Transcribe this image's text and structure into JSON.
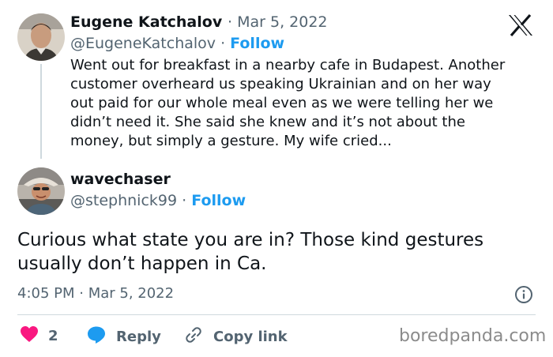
{
  "quoted_tweet": {
    "author_name": "Eugene Katchalov",
    "date": "Mar 5, 2022",
    "handle": "@EugeneKatchalov",
    "follow_label": "Follow",
    "text_lines": [
      "Went out for breakfast in a nearby cafe in Budapest. Another",
      "customer overheard us speaking Ukrainian and on her way",
      "out paid for our whole meal even as we were telling her we",
      "didn’t need it. She said she knew and it’s not about the",
      "money, but simply a gesture. My wife cried..."
    ]
  },
  "reply_tweet": {
    "author_name": "wavechaser",
    "handle": "@stephnick99",
    "follow_label": "Follow",
    "text_lines": [
      "Curious what state you are in? Those kind gestures",
      "usually don’t happen in Ca."
    ],
    "timestamp": "4:05 PM · Mar 5, 2022"
  },
  "actions": {
    "like_count": "2",
    "reply_label": "Reply",
    "copy_label": "Copy link"
  },
  "separator": "·",
  "watermark": "boredpanda.com",
  "colors": {
    "text": "#0f1419",
    "secondary": "#536471",
    "link": "#1d9bf0",
    "like": "#f91880",
    "reply_icon": "#1d9bf0"
  },
  "icons": {
    "logo": "x-logo-icon",
    "info": "info-icon",
    "like": "heart-icon",
    "reply": "speech-bubble-icon",
    "copy": "link-icon"
  }
}
